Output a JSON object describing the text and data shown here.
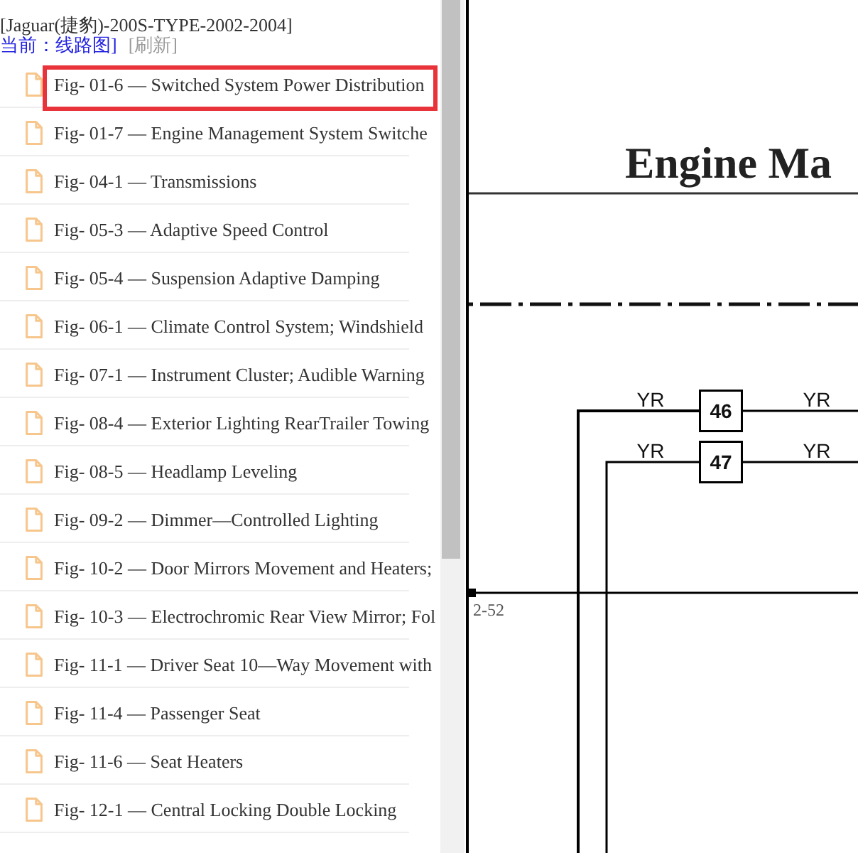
{
  "header": {
    "title": "[Jaguar(捷豹)-200S-TYPE-2002-2004]",
    "current": "当前：线路图]",
    "refresh": "[刷新]"
  },
  "figures": [
    {
      "label": "Fig- 01-6 — Switched System Power Distribution",
      "selected": true
    },
    {
      "label": "Fig- 01-7 — Engine Management System Switche",
      "selected": false
    },
    {
      "label": "Fig- 04-1 — Transmissions",
      "selected": false
    },
    {
      "label": "Fig- 05-3 — Adaptive Speed Control",
      "selected": false
    },
    {
      "label": "Fig- 05-4 — Suspension Adaptive Damping",
      "selected": false
    },
    {
      "label": "Fig- 06-1 — Climate Control System; Windshield",
      "selected": false
    },
    {
      "label": "Fig- 07-1 — Instrument Cluster; Audible Warning",
      "selected": false
    },
    {
      "label": "Fig- 08-4 — Exterior Lighting RearTrailer Towing",
      "selected": false
    },
    {
      "label": "Fig- 08-5 — Headlamp Leveling",
      "selected": false
    },
    {
      "label": "Fig- 09-2 — Dimmer—Controlled Lighting",
      "selected": false
    },
    {
      "label": "Fig- 10-2 — Door Mirrors Movement and Heaters;",
      "selected": false
    },
    {
      "label": "Fig- 10-3 — Electrochromic Rear View Mirror; Fol",
      "selected": false
    },
    {
      "label": "Fig- 11-1 — Driver Seat 10—Way Movement with",
      "selected": false
    },
    {
      "label": "Fig- 11-4 — Passenger Seat",
      "selected": false
    },
    {
      "label": "Fig- 11-6 — Seat Heaters",
      "selected": false
    },
    {
      "label": "Fig- 12-1 — Central Locking Double Locking",
      "selected": false
    }
  ],
  "diagram": {
    "title": "Engine Ma",
    "connectors": [
      {
        "number": "46",
        "wire_left": "YR",
        "wire_right": "YR"
      },
      {
        "number": "47",
        "wire_left": "YR",
        "wire_right": "YR"
      }
    ],
    "reference": "2-52"
  }
}
